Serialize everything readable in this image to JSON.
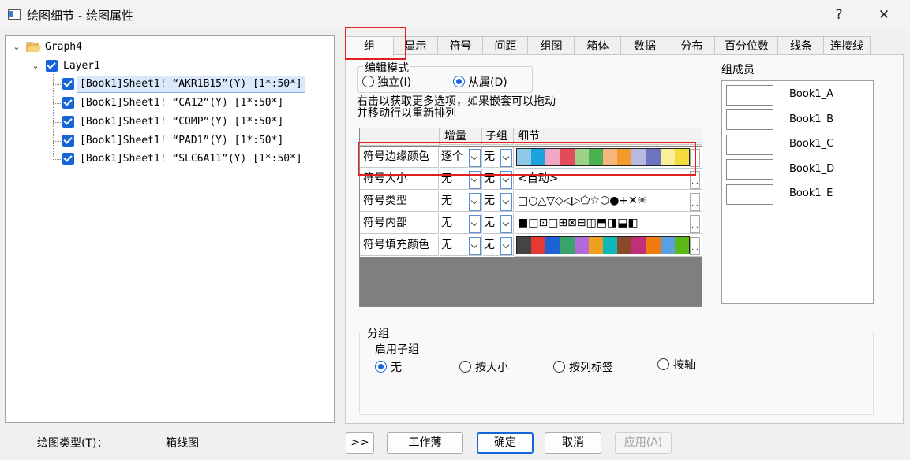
{
  "window": {
    "title": "绘图细节 - 绘图属性",
    "help_label": "?",
    "close_label": "✕"
  },
  "tree": {
    "root": {
      "label": "Graph4",
      "icon": "folder-icon"
    },
    "layer": {
      "label": "Layer1"
    },
    "plots": [
      {
        "label": "[Book1]Sheet1! “AKR1B15”(Y) [1*:50*]",
        "selected": true
      },
      {
        "label": "[Book1]Sheet1! “CA12”(Y) [1*:50*]",
        "selected": false
      },
      {
        "label": "[Book1]Sheet1! “COMP”(Y) [1*:50*]",
        "selected": false
      },
      {
        "label": "[Book1]Sheet1! “PAD1”(Y) [1*:50*]",
        "selected": false
      },
      {
        "label": "[Book1]Sheet1! “SLC6A11”(Y) [1*:50*]",
        "selected": false
      }
    ]
  },
  "plot_type": {
    "label": "绘图类型(T)：",
    "value": "箱线图"
  },
  "tabs": [
    "组",
    "显示",
    "符号",
    "间距",
    "组图",
    "箱体",
    "数据",
    "分布",
    "百分位数",
    "线条",
    "连接线"
  ],
  "active_tab": "组",
  "edit_mode": {
    "legend": "编辑模式",
    "independent": "独立(I)",
    "dependent": "从属(D)",
    "selected": "从属(D)"
  },
  "hint": {
    "line1": "右击以获取更多选项，如果嵌套可以拖动",
    "line2": "并移动行以重新排列"
  },
  "grid": {
    "headers": {
      "col1": "",
      "col2": "增量",
      "col3": "子组",
      "col4": "细节"
    },
    "rows": [
      {
        "name": "符号边缘颜色",
        "increment": "逐个",
        "subgroup": "无",
        "detail_type": "colors",
        "colors": [
          "#8fc9e8",
          "#1ca3dc",
          "#f3a6c1",
          "#e34a5a",
          "#9ed08a",
          "#4caf50",
          "#f6b57a",
          "#f39a2e",
          "#b9b9e0",
          "#6c74c4",
          "#f7ef9a",
          "#f3dc3c"
        ]
      },
      {
        "name": "符号大小",
        "increment": "无",
        "subgroup": "无",
        "detail_type": "text",
        "detail": "<自动>"
      },
      {
        "name": "符号类型",
        "increment": "无",
        "subgroup": "无",
        "detail_type": "text",
        "detail": "□○△▽◇◁▷⬠☆⬡●+✕✳"
      },
      {
        "name": "符号内部",
        "increment": "无",
        "subgroup": "无",
        "detail_type": "text",
        "detail": "■□⊡□⊞⊠⊟◫⬒◨⬓◧"
      },
      {
        "name": "符号填充颜色",
        "increment": "无",
        "subgroup": "无",
        "detail_type": "colors",
        "colors": [
          "#444444",
          "#e53935",
          "#1e63d6",
          "#3aa36a",
          "#b06bd8",
          "#f0a020",
          "#0fb8b8",
          "#8a4a2a",
          "#c0307a",
          "#f07a10",
          "#5aa0e0",
          "#5cb818"
        ]
      }
    ]
  },
  "members": {
    "title": "组成员",
    "items": [
      "Book1_A",
      "Book1_B",
      "Book1_C",
      "Book1_D",
      "Book1_E"
    ]
  },
  "grouping": {
    "legend": "分组",
    "subgroup_label": "启用子组",
    "options": [
      "无",
      "按大小",
      "按列标签",
      "按轴"
    ],
    "selected": "无"
  },
  "buttons": {
    "expand": ">>",
    "workbook": "工作薄",
    "ok": "确定",
    "cancel": "取消",
    "apply": "应用(A)"
  },
  "colors": {
    "accent": "#1565d8",
    "highlight": "#e41f1f"
  }
}
